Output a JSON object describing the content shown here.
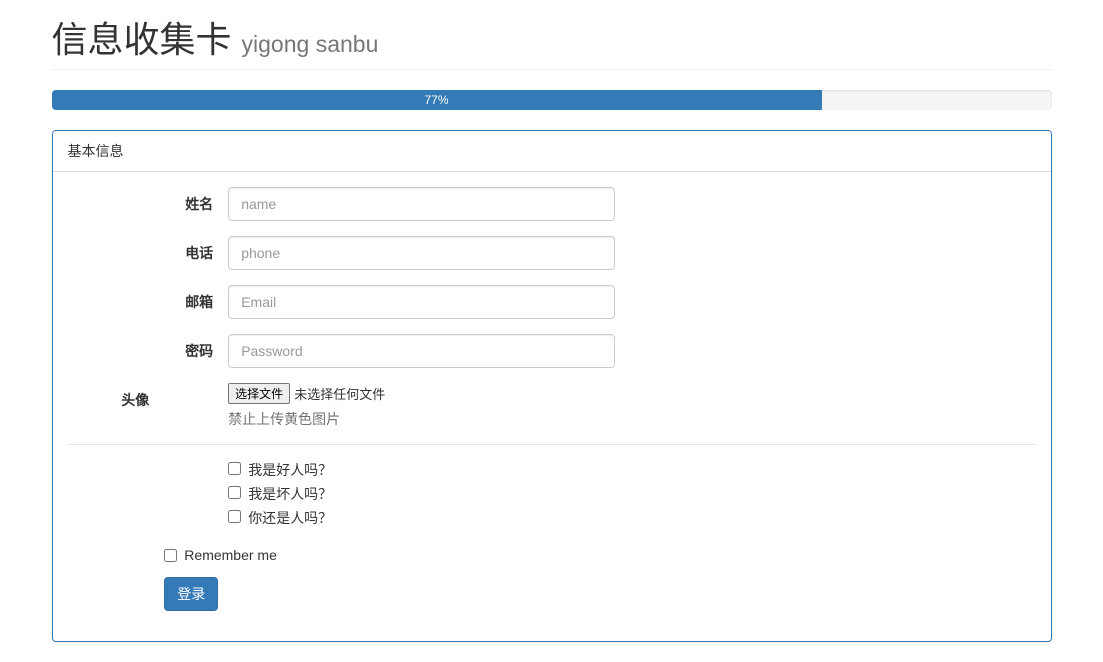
{
  "header": {
    "title": "信息收集卡",
    "subtitle": "yigong sanbu"
  },
  "progress": {
    "percent": 77,
    "label": "77%"
  },
  "panel": {
    "heading": "基本信息"
  },
  "form": {
    "name": {
      "label": "姓名",
      "placeholder": "name",
      "value": ""
    },
    "phone": {
      "label": "电话",
      "placeholder": "phone",
      "value": ""
    },
    "email": {
      "label": "邮箱",
      "placeholder": "Email",
      "value": ""
    },
    "password": {
      "label": "密码",
      "placeholder": "Password",
      "value": ""
    },
    "avatar": {
      "label": "头像",
      "file_button": "选择文件",
      "file_status": "未选择任何文件",
      "help": "禁止上传黄色图片"
    },
    "checkboxes": [
      "我是好人吗？",
      "我是坏人吗？",
      "你还是人吗？"
    ],
    "remember": "Remember me",
    "submit": "登录"
  }
}
